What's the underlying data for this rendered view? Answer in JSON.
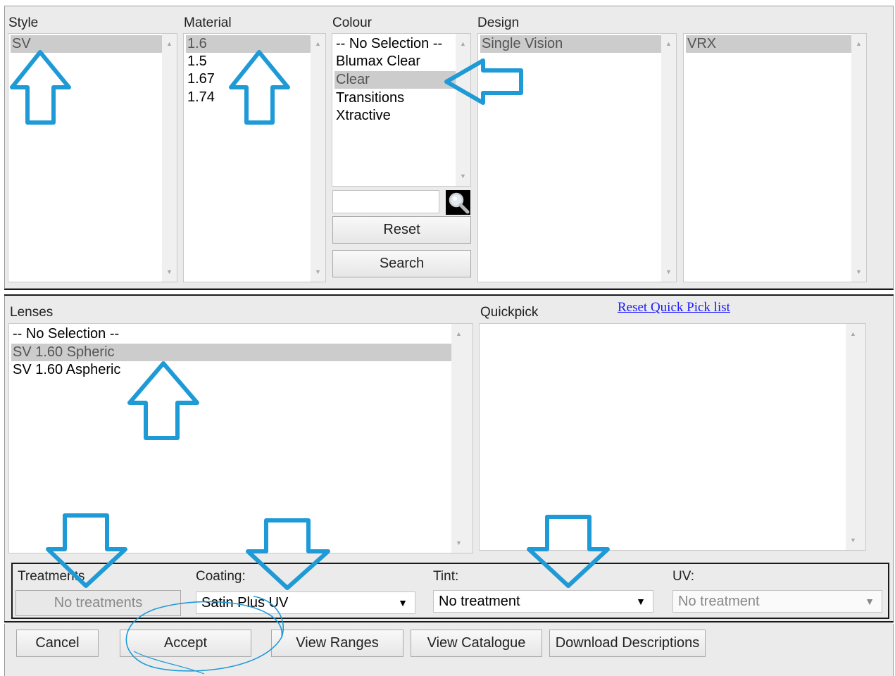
{
  "filters": {
    "style": {
      "label": "Style",
      "items": [
        "SV"
      ],
      "selected": "SV"
    },
    "material": {
      "label": "Material",
      "items": [
        "1.6",
        "1.5",
        "1.67",
        "1.74"
      ],
      "selected": "1.6"
    },
    "colour": {
      "label": "Colour",
      "items": [
        "-- No Selection --",
        "Blumax Clear",
        "Clear",
        "Transitions",
        "Xtractive"
      ],
      "selected": "Clear",
      "search_value": "",
      "reset_label": "Reset",
      "search_label": "Search"
    },
    "design": {
      "label": "Design",
      "items": [
        "Single Vision"
      ],
      "selected": "Single Vision"
    },
    "sub_design": {
      "items": [
        "VRX"
      ],
      "selected": "VRX"
    }
  },
  "lenses": {
    "label": "Lenses",
    "items": [
      "-- No Selection --",
      "SV 1.60 Spheric",
      "SV 1.60 Aspheric"
    ],
    "selected": "SV 1.60 Spheric"
  },
  "quickpick": {
    "label": "Quickpick",
    "reset_link": "Reset Quick Pick list",
    "items": []
  },
  "treatments": {
    "treatments_label": "Treatments",
    "treatments_button": "No treatments",
    "coating_label": "Coating:",
    "coating_value": "Satin Plus UV",
    "tint_label": "Tint:",
    "tint_value": "No treatment",
    "uv_label": "UV:",
    "uv_value": "No treatment"
  },
  "actions": {
    "cancel": "Cancel",
    "accept": "Accept",
    "view_ranges": "View Ranges",
    "view_catalogue": "View Catalogue",
    "download_descriptions": "Download Descriptions"
  },
  "icons": {
    "search": "magnifier-icon",
    "dropdown": "triangle-down-icon",
    "annotation": "arrow-icon"
  },
  "colors": {
    "annotation_arrow": "#1e9ad6",
    "selection": "#cccccc",
    "panel": "#ebebeb",
    "link": "#1a1aff"
  }
}
